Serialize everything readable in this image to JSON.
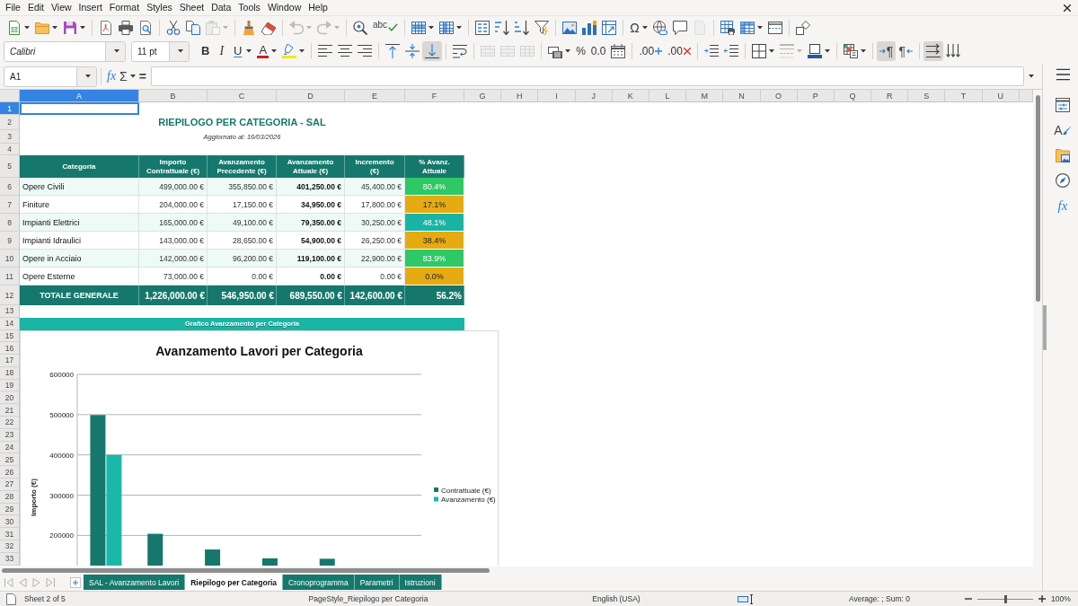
{
  "menu_bar": [
    "File",
    "Edit",
    "View",
    "Insert",
    "Format",
    "Styles",
    "Sheet",
    "Data",
    "Tools",
    "Window",
    "Help"
  ],
  "standard_toolbar": [
    {
      "disabled": false
    },
    {
      "disabled": false
    },
    {
      "disabled": false
    },
    {
      "disabled": false
    },
    {
      "disabled": false
    },
    {
      "disabled": false
    },
    {
      "disabled": false
    },
    {
      "disabled": false
    },
    {
      "disabled": true
    },
    {
      "disabled": false
    },
    {
      "disabled": false
    },
    {
      "disabled": true
    },
    {
      "disabled": true
    },
    {
      "disabled": false
    },
    {
      "label": "abc",
      "disabled": false
    },
    {
      "disabled": false
    },
    {
      "disabled": false
    },
    {
      "disabled": false
    },
    {
      "disabled": false
    },
    {
      "disabled": false
    },
    {
      "disabled": false
    },
    {
      "disabled": false
    },
    {
      "disabled": false
    },
    {
      "disabled": false
    },
    {
      "label": "Ω",
      "disabled": false
    },
    {
      "disabled": false
    },
    {
      "disabled": false
    },
    {
      "disabled": true
    },
    {
      "disabled": false
    },
    {
      "disabled": false
    },
    {
      "disabled": false
    },
    {
      "disabled": false
    }
  ],
  "formatting_toolbar": {
    "font_name": "Calibri",
    "font_size": "11 pt",
    "buttons": [
      {
        "label": "B",
        "disabled": false,
        "pressed": false
      },
      {
        "label": "I",
        "disabled": false,
        "pressed": false
      },
      {
        "label": "U",
        "disabled": false,
        "pressed": false
      },
      {
        "label": "A",
        "disabled": false,
        "pressed": false
      },
      {
        "disabled": false,
        "pressed": false
      },
      {
        "disabled": false,
        "pressed": false
      },
      {
        "disabled": false,
        "pressed": false
      },
      {
        "disabled": false,
        "pressed": false
      },
      {
        "disabled": false,
        "pressed": false
      },
      {
        "disabled": false,
        "pressed": false
      },
      {
        "disabled": false,
        "pressed": true
      },
      {
        "disabled": false,
        "pressed": false
      },
      {
        "disabled": true,
        "pressed": false
      },
      {
        "disabled": true,
        "pressed": false
      },
      {
        "disabled": true,
        "pressed": false
      },
      {
        "disabled": false,
        "pressed": false
      },
      {
        "label": "%",
        "disabled": false,
        "pressed": false
      },
      {
        "label": "0.0",
        "disabled": false,
        "pressed": false
      },
      {
        "disabled": false,
        "pressed": false
      },
      {
        "label": ".00",
        "disabled": false,
        "pressed": false
      },
      {
        "label": ".00",
        "disabled": false,
        "pressed": false
      },
      {
        "disabled": false,
        "pressed": false
      },
      {
        "disabled": false,
        "pressed": false
      },
      {
        "disabled": false,
        "pressed": false
      },
      {
        "disabled": true,
        "pressed": false
      },
      {
        "disabled": false,
        "pressed": false
      },
      {
        "disabled": false,
        "pressed": false
      },
      {
        "label": "¶",
        "disabled": false,
        "pressed": true
      },
      {
        "label": "¶",
        "disabled": false,
        "pressed": false
      },
      {
        "disabled": false,
        "pressed": true
      },
      {
        "disabled": false,
        "pressed": false
      }
    ]
  },
  "formula_bar": {
    "cell_reference": "A1",
    "buttons": [
      {
        "label": "fx"
      },
      {
        "label": "Σ"
      },
      {
        "label": "="
      }
    ]
  },
  "sheet": {
    "columns": [
      {
        "label": "A",
        "selected": true
      },
      {
        "label": "B",
        "selected": false
      },
      {
        "label": "C",
        "selected": false
      },
      {
        "label": "D",
        "selected": false
      },
      {
        "label": "E",
        "selected": false
      },
      {
        "label": "F",
        "selected": false
      },
      {
        "label": "G",
        "selected": false
      },
      {
        "label": "H",
        "selected": false
      },
      {
        "label": "I",
        "selected": false
      },
      {
        "label": "J",
        "selected": false
      },
      {
        "label": "K",
        "selected": false
      },
      {
        "label": "L",
        "selected": false
      },
      {
        "label": "M",
        "selected": false
      },
      {
        "label": "N",
        "selected": false
      },
      {
        "label": "O",
        "selected": false
      },
      {
        "label": "P",
        "selected": false
      },
      {
        "label": "Q",
        "selected": false
      },
      {
        "label": "R",
        "selected": false
      },
      {
        "label": "S",
        "selected": false
      },
      {
        "label": "T",
        "selected": false
      },
      {
        "label": "U",
        "selected": false
      }
    ],
    "rows": [
      {
        "label": "1",
        "selected": true
      },
      {
        "label": "2",
        "selected": false
      },
      {
        "label": "3",
        "selected": false
      },
      {
        "label": "4",
        "selected": false
      },
      {
        "label": "5",
        "selected": false
      },
      {
        "label": "6",
        "selected": false
      },
      {
        "label": "7",
        "selected": false
      },
      {
        "label": "8",
        "selected": false
      },
      {
        "label": "9",
        "selected": false
      },
      {
        "label": "10",
        "selected": false
      },
      {
        "label": "11",
        "selected": false
      },
      {
        "label": "12",
        "selected": false
      },
      {
        "label": "13",
        "selected": false
      },
      {
        "label": "14",
        "selected": false
      },
      {
        "label": "15",
        "selected": false
      },
      {
        "label": "16",
        "selected": false
      },
      {
        "label": "17",
        "selected": false
      },
      {
        "label": "18",
        "selected": false
      },
      {
        "label": "19",
        "selected": false
      },
      {
        "label": "20",
        "selected": false
      },
      {
        "label": "21",
        "selected": false
      },
      {
        "label": "22",
        "selected": false
      },
      {
        "label": "23",
        "selected": false
      },
      {
        "label": "24",
        "selected": false
      },
      {
        "label": "25",
        "selected": false
      },
      {
        "label": "26",
        "selected": false
      },
      {
        "label": "27",
        "selected": false
      },
      {
        "label": "28",
        "selected": false
      },
      {
        "label": "29",
        "selected": false
      },
      {
        "label": "30",
        "selected": false
      },
      {
        "label": "31",
        "selected": false
      },
      {
        "label": "32",
        "selected": false
      },
      {
        "label": "33",
        "selected": false
      }
    ],
    "title": "RIEPILOGO PER CATEGORIA - SAL",
    "subtitle": "Aggiornato al: 16/03/2026",
    "table": {
      "columns": [
        "Categoria",
        "Importo\nContrattuale (€)",
        "Avanzamento\nPrecedente (€)",
        "Avanzamento\nAttuale (€)",
        "Incremento\n(€)",
        "% Avanz.\nAttuale"
      ],
      "rows": [
        {
          "cells": [
            "Opere Civili",
            "499,000.00 €",
            "355,850.00 €",
            "401,250.00 €",
            "45,400.00 €",
            "80.4%"
          ],
          "color": "#2ec866"
        },
        {
          "cells": [
            "Finiture",
            "204,000.00 €",
            "17,150.00 €",
            "34,950.00 €",
            "17,800.00 €",
            "17.1%"
          ],
          "color": "#e6ab12"
        },
        {
          "cells": [
            "Impianti Elettrici",
            "165,000.00 €",
            "49,100.00 €",
            "79,350.00 €",
            "30,250.00 €",
            "48.1%"
          ],
          "color": "#1ab4a4"
        },
        {
          "cells": [
            "Impianti Idraulici",
            "143,000.00 €",
            "28,650.00 €",
            "54,900.00 €",
            "26,250.00 €",
            "38.4%"
          ],
          "color": "#e6ab12"
        },
        {
          "cells": [
            "Opere in Acciaio",
            "142,000.00 €",
            "96,200.00 €",
            "119,100.00 €",
            "22,900.00 €",
            "83.9%"
          ],
          "color": "#2ec866"
        },
        {
          "cells": [
            "Opere Esterne",
            "73,000.00 €",
            "0.00 €",
            "0.00 €",
            "0.00 €",
            "0.0%"
          ],
          "color": "#e6ab12"
        }
      ],
      "total": [
        "TOTALE GENERALE",
        "1,226,000.00 €",
        "546,950.00 €",
        "689,550.00 €",
        "142,600.00 €",
        "56.2%"
      ]
    },
    "chart_banner": "Grafico Avanzamento per Categoria",
    "chart": {
      "chart_data": {
        "type": "bar",
        "title": "Avanzamento Lavori per Categoria",
        "ylabel": "Importo (€)",
        "ylim": [
          125000,
          600000
        ],
        "yticks": [
          200000,
          300000,
          400000,
          500000,
          600000
        ],
        "stacked": false,
        "grid": true,
        "legend": "right",
        "series": [
          {
            "name": "Contrattuale (€)",
            "color": "#16786c",
            "values": [
              499000,
              204000,
              165000,
              143000,
              142000,
              null
            ]
          },
          {
            "name": "Avanzamento (€)",
            "color": "#1ab8a8",
            "values": [
              400000,
              null,
              null,
              null,
              null,
              null
            ]
          }
        ]
      }
    }
  },
  "sheet_tabs": [
    {
      "label": "SAL - Avanzamento Lavori",
      "selected": false
    },
    {
      "label": "Riepilogo per Categoria",
      "selected": true
    },
    {
      "label": "Cronoprogramma",
      "selected": false
    },
    {
      "label": "Parametri",
      "selected": false
    },
    {
      "label": "Istruzioni",
      "selected": false
    }
  ],
  "sidebar": [
    {
      "selected": false
    },
    {
      "label": "A",
      "selected": false
    },
    {
      "selected": false
    },
    {
      "selected": false
    },
    {
      "label": "fx",
      "selected": false
    }
  ],
  "status_bar": {
    "sheet_position": "Sheet 2 of 5",
    "page_style": "PageStyle_Riepilogo per Categoria",
    "language": "English (USA)",
    "selection_summary": "Average: ; Sum: 0",
    "zoom_slider": {
      "level": 0.5
    },
    "zoom": "100%"
  }
}
